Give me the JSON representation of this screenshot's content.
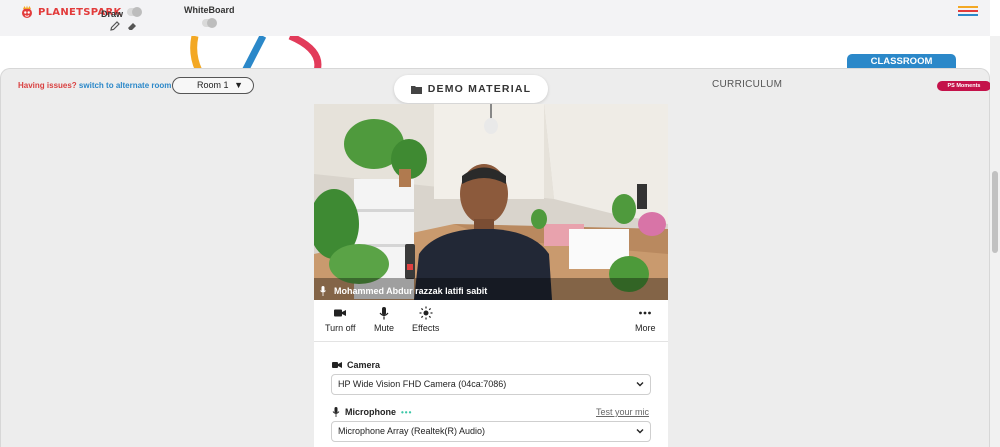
{
  "app": {
    "brand": "PLANETSPARK"
  },
  "toolbar": {
    "draw_label": "Draw",
    "whiteboard_label": "WhiteBoard"
  },
  "nav": {
    "classroom_tab": "CLASSROOM",
    "issues_prefix": "Having issues?",
    "issues_link": "switch to alternate room",
    "room_selected": "Room 1",
    "demo_material": "DEMO MATERIAL",
    "curriculum": "CURRICULUM",
    "ps_moments": "PS Moments"
  },
  "camera_panel": {
    "participant_name": "Mohammed Abdur razzak latifi sabit",
    "controls": {
      "turn_off": "Turn off",
      "mute": "Mute",
      "effects": "Effects",
      "more": "More"
    },
    "camera_label": "Camera",
    "camera_device": "HP Wide Vision FHD Camera (04ca:7086)",
    "microphone_label": "Microphone",
    "test_mic": "Test your mic",
    "microphone_device": "Microphone Array (Realtek(R) Audio)"
  },
  "colors": {
    "brand_red": "#e23b3b",
    "classroom_blue": "#2b88c9",
    "ps_moments": "#c4124a",
    "mic_level": "#3cc7a7"
  }
}
